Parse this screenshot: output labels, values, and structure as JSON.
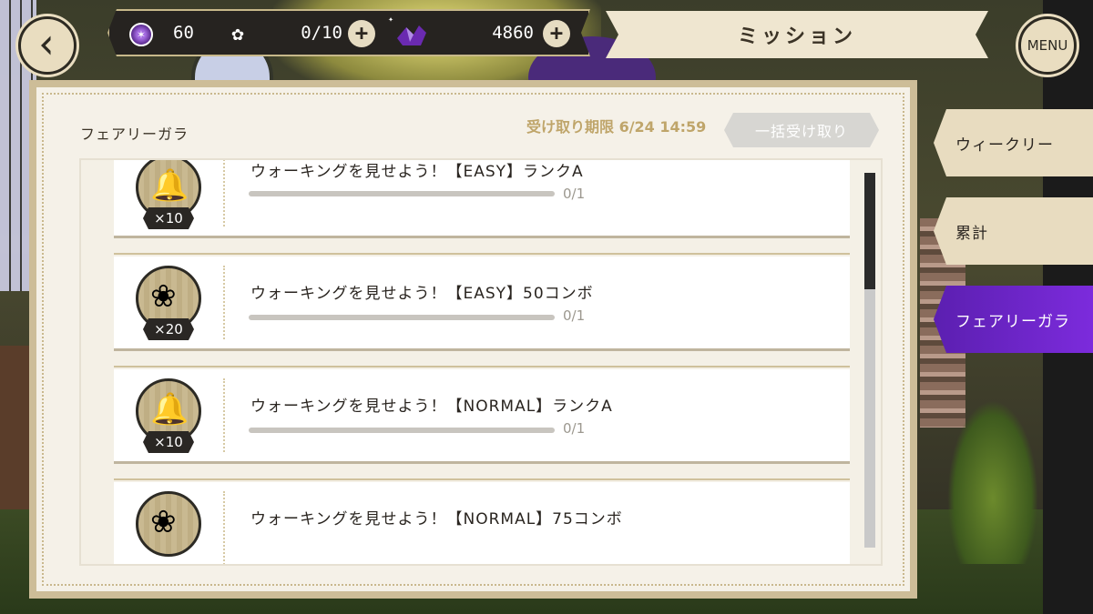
{
  "topbar": {
    "gems": "60",
    "stamina": "0/10",
    "tickets": "4860",
    "title": "ミッション",
    "menu_label": "MENU"
  },
  "tabs": [
    {
      "label": "ウィークリー",
      "active": false
    },
    {
      "label": "累計",
      "active": false
    },
    {
      "label": "フェアリーガラ",
      "active": true
    }
  ],
  "panel": {
    "title": "フェアリーガラ",
    "deadline": "受け取り期限 6/24 14:59",
    "claim_all_label": "一括受け取り"
  },
  "missions": [
    {
      "title": "ウォーキングを見せよう！【EASY】ランクA",
      "progress": "0/1",
      "progress_value": 0,
      "reward_qty": "×10",
      "reward_icon": "bell-icon"
    },
    {
      "title": "ウォーキングを見せよう！【EASY】50コンボ",
      "progress": "0/1",
      "progress_value": 0,
      "reward_qty": "×20",
      "reward_icon": "flower-icon"
    },
    {
      "title": "ウォーキングを見せよう！【NORMAL】ランクA",
      "progress": "0/1",
      "progress_value": 0,
      "reward_qty": "×10",
      "reward_icon": "bell-icon"
    },
    {
      "title": "ウォーキングを見せよう！【NORMAL】75コンボ",
      "progress": "",
      "progress_value": 0,
      "reward_qty": "",
      "reward_icon": "flower-icon"
    }
  ],
  "colors": {
    "active_tab": "#6a25c8",
    "gold": "#bfa56a",
    "panel_border": "#cdbd98"
  }
}
